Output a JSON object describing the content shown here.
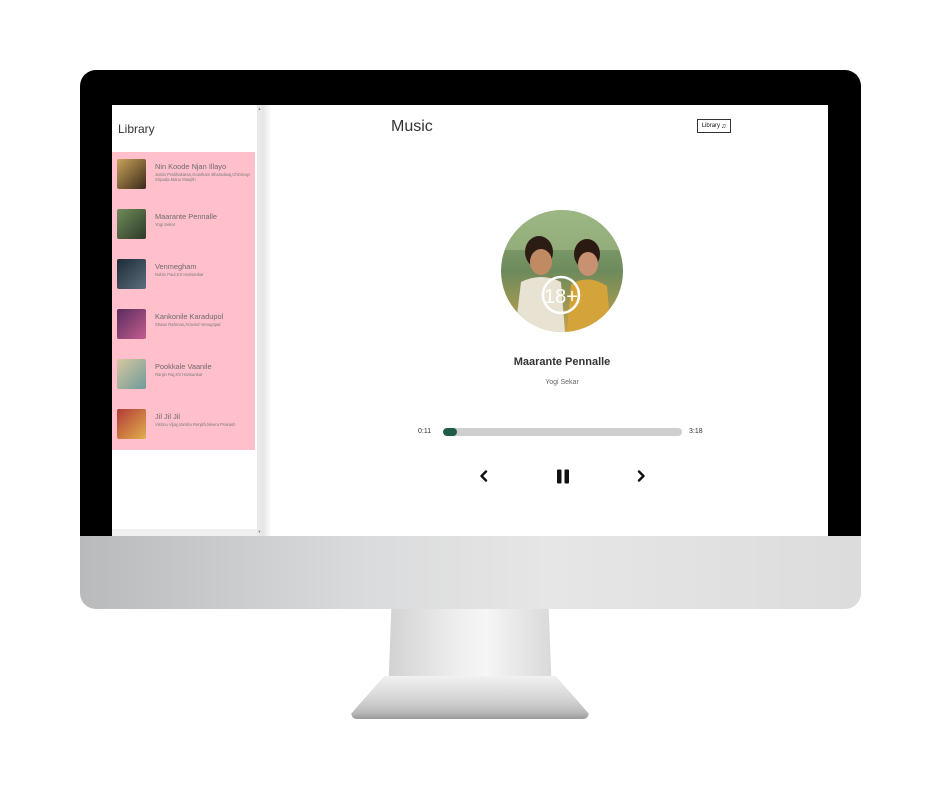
{
  "sidebar": {
    "title": "Library",
    "songs": [
      {
        "name": "Nin Koode Njan Illayo",
        "artist": "Justin Prabhakaran,Gowtham Bharadwaj,Chinmayi Sripada,Manu Manjith",
        "cover_colors": [
          "#c9a35b",
          "#3b2a1a"
        ]
      },
      {
        "name": "Maarante Pennalle",
        "artist": "Yogi Sekar",
        "cover_colors": [
          "#6f8c5a",
          "#2d3a28"
        ]
      },
      {
        "name": "Venmegham",
        "artist": "Nobin Paul,KS Harisankar",
        "cover_colors": [
          "#1d2a36",
          "#5b6e7c"
        ]
      },
      {
        "name": "Kankonile Karadupol",
        "artist": "Shaan Rahman,Aravind Venugopal",
        "cover_colors": [
          "#5a2c5e",
          "#c45c8e"
        ]
      },
      {
        "name": "Pookkale Vaanile",
        "artist": "Ranjin Raj,KS Harisankar",
        "cover_colors": [
          "#d9c7a0",
          "#6e9b9a"
        ]
      },
      {
        "name": "Jil Jil Jil",
        "artist": "Vishnu Vijay,Varsha Renjith,Meera Prakash",
        "cover_colors": [
          "#b23a3a",
          "#e2b04a"
        ]
      }
    ]
  },
  "header": {
    "title": "Music",
    "library_button": "Library",
    "music_icon": "music-note-icon"
  },
  "player": {
    "title": "Maarante Pennalle",
    "artist": "Yogi Sekar",
    "current_time": "0:11",
    "total_time": "3:18",
    "progress": 0.058
  },
  "colors": {
    "sidebar_bg": "#ffc0cb",
    "progress_fill": "#1f5c4a",
    "progress_track": "#cfcfcf"
  }
}
